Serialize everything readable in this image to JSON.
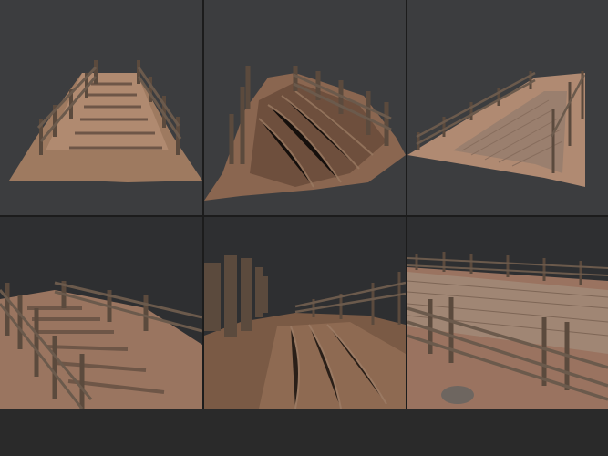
{
  "tiles": [
    {
      "name": "stairs-bridge-front",
      "background": "#3c3d3f"
    },
    {
      "name": "muddy-trench-angled",
      "background": "#3c3d3f"
    },
    {
      "name": "cobble-path-top",
      "background": "#3c3d3f"
    },
    {
      "name": "stairs-bridge-closeup",
      "background": "#2e2f31"
    },
    {
      "name": "trench-ground-level",
      "background": "#2e2f31"
    },
    {
      "name": "cobble-path-closeup",
      "background": "#2e2f31"
    }
  ],
  "colors": {
    "wood": "#6b5a4c",
    "wood_dark": "#4a3d33",
    "dirt": "#a07a60",
    "dirt_dark": "#7a5a45",
    "stone": "#8a7a6c"
  }
}
